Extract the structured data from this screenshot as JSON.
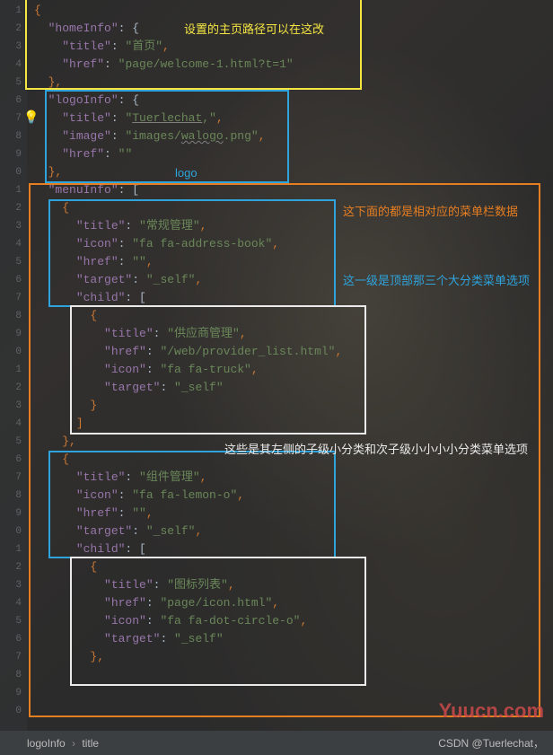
{
  "lineNumbers": [
    "1",
    "2",
    "3",
    "4",
    "5",
    "6",
    "7",
    "8",
    "9",
    "0",
    "1",
    "2",
    "3",
    "4",
    "5",
    "6",
    "7",
    "8",
    "9",
    "0",
    "1",
    "2",
    "3",
    "4",
    "5",
    "6",
    "7",
    "8",
    "9",
    "0",
    "1",
    "2",
    "3",
    "4",
    "5",
    "6",
    "7",
    "8",
    "9",
    "0"
  ],
  "code": {
    "l1_brace": "{",
    "l2_key": "\"homeInfo\"",
    "l2_after": ": {",
    "l3_key": "\"title\"",
    "l3_val": "\"首页\"",
    "comma": ",",
    "l4_key": "\"href\"",
    "l4_val": "\"page/welcome-1.html?t=1\"",
    "l5_close": "},",
    "l6_key": "\"logoInfo\"",
    "l6_after": ": {",
    "l7_key": "\"title\"",
    "l7_val_open": "\"",
    "l7_val_text": "Tuerlechat",
    "l7_val_close": ",\"",
    "l7_comma": ",",
    "l8_key": "\"image\"",
    "l8_val_open": "\"images/",
    "l8_val_text": "walogo",
    "l8_val_close": ".png\"",
    "l9_key": "\"href\"",
    "l9_val": "\"\"",
    "l10_close": "},",
    "l11_key": "\"menuInfo\"",
    "l11_after": ": [",
    "l12_brace": "{",
    "l13_key": "\"title\"",
    "l13_val": "\"常规管理\"",
    "l14_key": "\"icon\"",
    "l14_val": "\"fa fa-address-book\"",
    "l15_key": "\"href\"",
    "l15_val": "\"\"",
    "l16_key": "\"target\"",
    "l16_val": "\"_self\"",
    "l17_key": "\"child\"",
    "l17_after": ": [",
    "l18_brace": "{",
    "l19_key": "\"title\"",
    "l19_val": "\"供应商管理\"",
    "l20_key": "\"href\"",
    "l20_val": "\"/web/provider_list.html\"",
    "l21_key": "\"icon\"",
    "l21_val": "\"fa fa-truck\"",
    "l22_key": "\"target\"",
    "l22_val": "\"_self\"",
    "l23_close": "}",
    "l24_close": "]",
    "l25_close": "},",
    "l26_brace": "{",
    "l27_key": "\"title\"",
    "l27_val": "\"组件管理\"",
    "l28_key": "\"icon\"",
    "l28_val": "\"fa fa-lemon-o\"",
    "l29_key": "\"href\"",
    "l29_val": "\"\"",
    "l30_key": "\"target\"",
    "l30_val": "\"_self\"",
    "l31_key": "\"child\"",
    "l31_after": ": [",
    "l32_brace": "{",
    "l33_key": "\"title\"",
    "l33_val": "\"图标列表\"",
    "l34_key": "\"href\"",
    "l34_val": "\"page/icon.html\"",
    "l35_key": "\"icon\"",
    "l35_val": "\"fa fa-dot-circle-o\"",
    "l36_key": "\"target\"",
    "l36_val": "\"_self\"",
    "l37_close": "},"
  },
  "annotations": {
    "yellow": "设置的主页路径可以在这改",
    "blueLogo": "logo",
    "orange1": "这下面的都是相对应的菜单栏数据",
    "blue2": "这一级是顶部那三个大分类菜单选项",
    "white1": "这些是其左侧的子级小分类和次子级小小小小分类菜单选项"
  },
  "watermark": "Yuucn.com",
  "footer": {
    "crumb1": "logoInfo",
    "crumb2": "title",
    "right": "CSDN @Tuerlechat，"
  }
}
